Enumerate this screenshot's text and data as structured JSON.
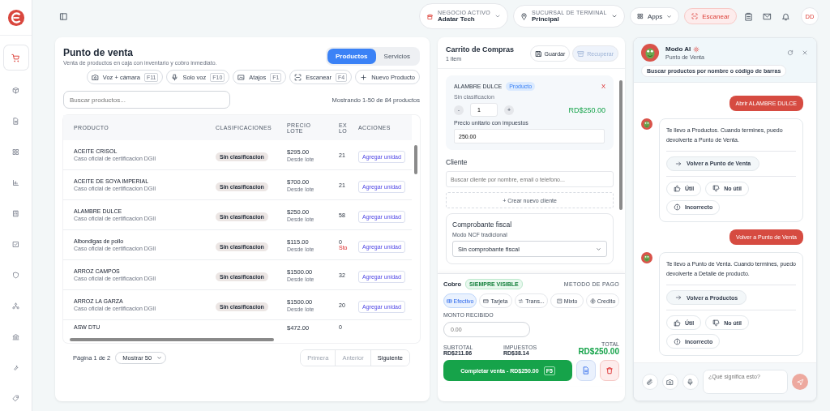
{
  "header": {
    "business": {
      "label": "NEGOCIO ACTIVO",
      "value": "Adatar Tech"
    },
    "branch": {
      "label": "SUCURSAL DE TERMINAL",
      "value": "Principal"
    },
    "apps": "Apps",
    "scan": "Escanear",
    "avatar": "DD"
  },
  "sidebar": {
    "items": [
      {
        "selected": true
      },
      {
        "selected": false
      },
      {
        "selected": false
      },
      {
        "selected": false
      },
      {
        "selected": false
      },
      {
        "selected": false
      },
      {
        "selected": false
      },
      {
        "selected": false
      },
      {
        "selected": false
      },
      {
        "selected": false
      },
      {
        "selected": false
      },
      {
        "selected": false
      }
    ]
  },
  "pos": {
    "title": "Punto de venta",
    "subtitle": "Venta de productos en caja con inventario y cobro inmediato.",
    "tabs": [
      {
        "label": "Productos",
        "selected": true
      },
      {
        "label": "Servicios",
        "selected": false
      }
    ],
    "actions": [
      {
        "label": "Voz + cámara",
        "key": "F11"
      },
      {
        "label": "Solo voz",
        "key": "F10"
      },
      {
        "label": "Atajos",
        "key": "F1"
      },
      {
        "label": "Escanear",
        "key": "F4"
      },
      {
        "label": "Nuevo Producto"
      }
    ],
    "search": {
      "placeholder": "Buscar productos..."
    },
    "count": "Mostrando 1-50 de 84 productos",
    "table": {
      "columns": [
        "PRODUCTO",
        "CLASIFICACIONES",
        "PRECIO LOTE",
        "EX LO",
        "ACCIONES"
      ],
      "rows": [
        {
          "name": "ACEITE CRISOL",
          "note": "Caso oficial de certificacion DGII",
          "tag": "Sin clasificacion",
          "price": "$295.00",
          "price_note": "Desde lote",
          "stock": "21",
          "action": "Agregar unidad"
        },
        {
          "name": "ACEITE DE SOYA IMPERIAL",
          "note": "Caso oficial de certificacion DGII",
          "tag": "Sin clasificacion",
          "price": "$700.00",
          "price_note": "Desde lote",
          "stock": "21",
          "action": "Agregar unidad"
        },
        {
          "name": "ALAMBRE DULCE",
          "note": "Caso oficial de certificacion DGII",
          "tag": "Sin clasificacion",
          "price": "$250.00",
          "price_note": "Desde lote",
          "stock": "58",
          "action": "Agregar unidad"
        },
        {
          "name": "Albondigas de pollo",
          "note": "Caso oficial de certificacion DGII",
          "tag": "Sin clasificacion",
          "price": "$115.00",
          "price_note": "Desde lote",
          "stock": "0",
          "stock_note": "Sto",
          "action": "Agregar unidad"
        },
        {
          "name": "ARROZ CAMPOS",
          "note": "Caso oficial de certificacion DGII",
          "tag": "Sin clasificacion",
          "price": "$1500.00",
          "price_note": "Desde lote",
          "stock": "32",
          "action": "Agregar unidad"
        },
        {
          "name": "ARROZ LA GARZA",
          "note": "Caso oficial de certificacion DGII",
          "tag": "Sin clasificacion",
          "price": "$1500.00",
          "price_note": "Desde lote",
          "stock": "20",
          "action": "Agregar unidad"
        },
        {
          "name": "ASW DTU",
          "price": "$472.00",
          "stock": "0"
        }
      ]
    },
    "pagination": {
      "page": "Página 1 de 2",
      "page_size": "Mostrar 50",
      "buttons": [
        {
          "label": "Primera",
          "disabled": true
        },
        {
          "label": "Anterior",
          "disabled": true
        },
        {
          "label": "Siguiente",
          "disabled": false
        }
      ]
    }
  },
  "cart": {
    "title": "Carrito de Compras",
    "count": "1 item",
    "buttons": [
      {
        "label": "Guardar",
        "disabled": false
      },
      {
        "label": "Recuperar",
        "disabled": true
      }
    ],
    "items": [
      {
        "name": "ALAMBRE DULCE",
        "tag": "Producto",
        "classification": "Sin clasificacion",
        "remove": "X",
        "minus": "-",
        "qty": "1",
        "plus": "+",
        "total": "RD$250.00",
        "price_label": "Precio unitario con impuestos",
        "price": "250.00"
      }
    ],
    "client": {
      "title": "Cliente",
      "placeholder": "Buscar cliente por nombre, email o telefono...",
      "create": "+ Crear nuevo cliente"
    },
    "fiscal": {
      "title": "Comprobante fiscal",
      "mode": "Modo NCF tradicional",
      "value": "Sin comprobante fiscal"
    }
  },
  "payment": {
    "title": "Cobro",
    "badge": "SIEMPRE VISIBLE",
    "method_label": "METODO DE PAGO",
    "methods": [
      {
        "label": "Efectivo",
        "selected": true
      },
      {
        "label": "Tarjeta",
        "selected": false
      },
      {
        "label": "Trans...",
        "selected": false
      },
      {
        "label": "Mixto",
        "selected": false
      },
      {
        "label": "Credito",
        "selected": false
      }
    ],
    "received_label": "MONTO RECIBIDO",
    "received_placeholder": "0.00",
    "subtotal": {
      "label": "SUBTOTAL",
      "value": "RD$211.86"
    },
    "taxes": {
      "label": "IMPUESTOS",
      "value": "RD$38.14"
    },
    "total": {
      "label": "TOTAL",
      "value": "RD$250.00"
    },
    "complete": {
      "label": "Completar venta - RD$250.00",
      "key": "F5"
    }
  },
  "assistant": {
    "title": "Modo AI",
    "subtitle": "Punto de Venta",
    "chip": "Buscar productos por nombre o código de barras",
    "messages": [
      {
        "kind": "user",
        "text": "Abrir ALAMBRE DULCE"
      },
      {
        "kind": "bot",
        "text": "Te llevo a Productos. Cuando termines, puedo devolverte a Punto de Venta.",
        "action": "Volver a Punto de Venta",
        "feedback": [
          "Útil",
          "No útil",
          "Incorrecto"
        ]
      },
      {
        "kind": "user",
        "text": "Volver a Punto de Venta"
      },
      {
        "kind": "bot",
        "text": "Te llevo a Punto de Venta. Cuando termines, puedo devolverte a Detalle de producto.",
        "action": "Volver a Productos",
        "feedback": [
          "Útil",
          "No útil",
          "Incorrecto"
        ]
      }
    ],
    "input_placeholder": "¿Qué significa esto?"
  }
}
